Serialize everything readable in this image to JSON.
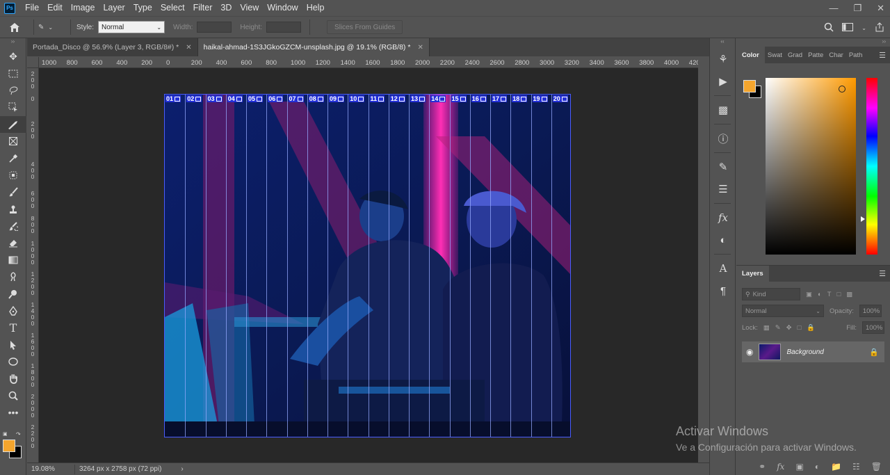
{
  "menu": {
    "logo": "Ps",
    "items": [
      "File",
      "Edit",
      "Image",
      "Layer",
      "Type",
      "Select",
      "Filter",
      "3D",
      "View",
      "Window",
      "Help"
    ]
  },
  "options": {
    "style_label": "Style:",
    "style_value": "Normal",
    "width_label": "Width:",
    "height_label": "Height:",
    "slices_button": "Slices From Guides"
  },
  "tabs": [
    {
      "label": "Portada_Disco @ 56.9% (Layer 3, RGB/8#) *",
      "active": false
    },
    {
      "label": "haikal-ahmad-1S3JGkoGZCM-unsplash.jpg @ 19.1% (RGB/8) *",
      "active": true
    }
  ],
  "ruler": {
    "top_labels": [
      "1000",
      "800",
      "600",
      "400",
      "200",
      "0",
      "200",
      "400",
      "600",
      "800",
      "1000",
      "1200",
      "1400",
      "1600",
      "1800",
      "2000",
      "2200",
      "2400",
      "2600",
      "2800",
      "3000",
      "3200",
      "3400",
      "3600",
      "3800",
      "4000",
      "420"
    ]
  },
  "slices": [
    "01",
    "02",
    "03",
    "04",
    "05",
    "06",
    "07",
    "08",
    "09",
    "10",
    "11",
    "12",
    "13",
    "14",
    "15",
    "16",
    "17",
    "18",
    "19",
    "20"
  ],
  "status": {
    "zoom": "19.08%",
    "doc_size": "3264 px x 2758 px (72 ppi)"
  },
  "color_panel": {
    "tabs": [
      "Color",
      "Swat",
      "Grad",
      "Patte",
      "Char",
      "Path"
    ],
    "foreground": "#f4a52d",
    "background": "#000000"
  },
  "layers_panel": {
    "title": "Layers",
    "kind_placeholder": "Kind",
    "blend_mode": "Normal",
    "opacity_label": "Opacity:",
    "opacity_value": "100%",
    "lock_label": "Lock:",
    "fill_label": "Fill:",
    "fill_value": "100%",
    "layer_name": "Background"
  },
  "watermark": {
    "line1": "Activar Windows",
    "line2": "Ve a Configuración para activar Windows."
  }
}
